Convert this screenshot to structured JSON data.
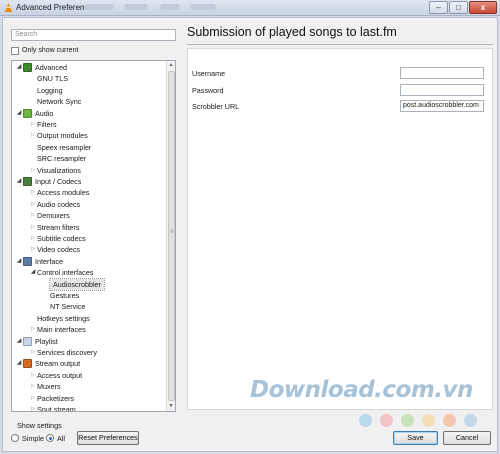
{
  "window": {
    "title": "Advanced Preferences",
    "minimize": "–",
    "maximize": "□",
    "close": "x"
  },
  "left_pane": {
    "search_placeholder": "Search",
    "only_show_current_label": "Only show current"
  },
  "tree": [
    {
      "label": "Advanced",
      "depth": 0,
      "arrow": "open",
      "icon": "advanced-icon",
      "icon_color": "#3c8a2e"
    },
    {
      "label": "GNU TLS",
      "depth": 1,
      "arrow": "none"
    },
    {
      "label": "Logging",
      "depth": 1,
      "arrow": "none"
    },
    {
      "label": "Network Sync",
      "depth": 1,
      "arrow": "none"
    },
    {
      "label": "Audio",
      "depth": 0,
      "arrow": "open",
      "icon": "audio-icon",
      "icon_color": "#6db33f"
    },
    {
      "label": "Filters",
      "depth": 1,
      "arrow": "closed"
    },
    {
      "label": "Output modules",
      "depth": 1,
      "arrow": "closed"
    },
    {
      "label": "Speex resampler",
      "depth": 1,
      "arrow": "none"
    },
    {
      "label": "SRC resampler",
      "depth": 1,
      "arrow": "none"
    },
    {
      "label": "Visualizations",
      "depth": 1,
      "arrow": "closed"
    },
    {
      "label": "Input / Codecs",
      "depth": 0,
      "arrow": "open",
      "icon": "input-codecs-icon",
      "icon_color": "#4a7f3a"
    },
    {
      "label": "Access modules",
      "depth": 1,
      "arrow": "closed"
    },
    {
      "label": "Audio codecs",
      "depth": 1,
      "arrow": "closed"
    },
    {
      "label": "Demuxers",
      "depth": 1,
      "arrow": "closed"
    },
    {
      "label": "Stream filters",
      "depth": 1,
      "arrow": "closed"
    },
    {
      "label": "Subtitle codecs",
      "depth": 1,
      "arrow": "closed"
    },
    {
      "label": "Video codecs",
      "depth": 1,
      "arrow": "closed"
    },
    {
      "label": "Interface",
      "depth": 0,
      "arrow": "open",
      "icon": "interface-icon",
      "icon_color": "#5b7aa6"
    },
    {
      "label": "Control interfaces",
      "depth": 1,
      "arrow": "open"
    },
    {
      "label": "Audioscrobbler",
      "depth": 2,
      "arrow": "none",
      "selected": true
    },
    {
      "label": "Gestures",
      "depth": 2,
      "arrow": "none"
    },
    {
      "label": "NT Service",
      "depth": 2,
      "arrow": "none"
    },
    {
      "label": "Hotkeys settings",
      "depth": 1,
      "arrow": "none"
    },
    {
      "label": "Main interfaces",
      "depth": 1,
      "arrow": "closed"
    },
    {
      "label": "Playlist",
      "depth": 0,
      "arrow": "open",
      "icon": "playlist-icon",
      "icon_color": "#c9d4e4"
    },
    {
      "label": "Services discovery",
      "depth": 1,
      "arrow": "closed"
    },
    {
      "label": "Stream output",
      "depth": 0,
      "arrow": "open",
      "icon": "stream-output-icon",
      "icon_color": "#d2691e"
    },
    {
      "label": "Access output",
      "depth": 1,
      "arrow": "closed"
    },
    {
      "label": "Muxers",
      "depth": 1,
      "arrow": "closed"
    },
    {
      "label": "Packetizers",
      "depth": 1,
      "arrow": "closed"
    },
    {
      "label": "Sout stream",
      "depth": 1,
      "arrow": "closed"
    }
  ],
  "panel": {
    "title": "Submission of played songs to last.fm",
    "username_label": "Username",
    "username_value": "",
    "password_label": "Password",
    "password_value": "",
    "scrobbler_url_label": "Scrobbler URL",
    "scrobbler_url_value": "post.audioscrobbler.com"
  },
  "bottom": {
    "show_settings_label": "Show settings",
    "simple_label": "Simple",
    "all_label": "All",
    "selected_mode": "All",
    "reset_label": "Reset Preferences",
    "save_label": "Save",
    "cancel_label": "Cancel"
  },
  "watermark": {
    "text": "Download.com.vn",
    "dot_colors": [
      "#8ec9ea",
      "#f2a3a3",
      "#a7d98f",
      "#f6cf86",
      "#f5a77a",
      "#9fc2e8"
    ]
  },
  "colors": {
    "accent_blue": "#3c7fb1",
    "vlc_orange": "#f08a00"
  }
}
